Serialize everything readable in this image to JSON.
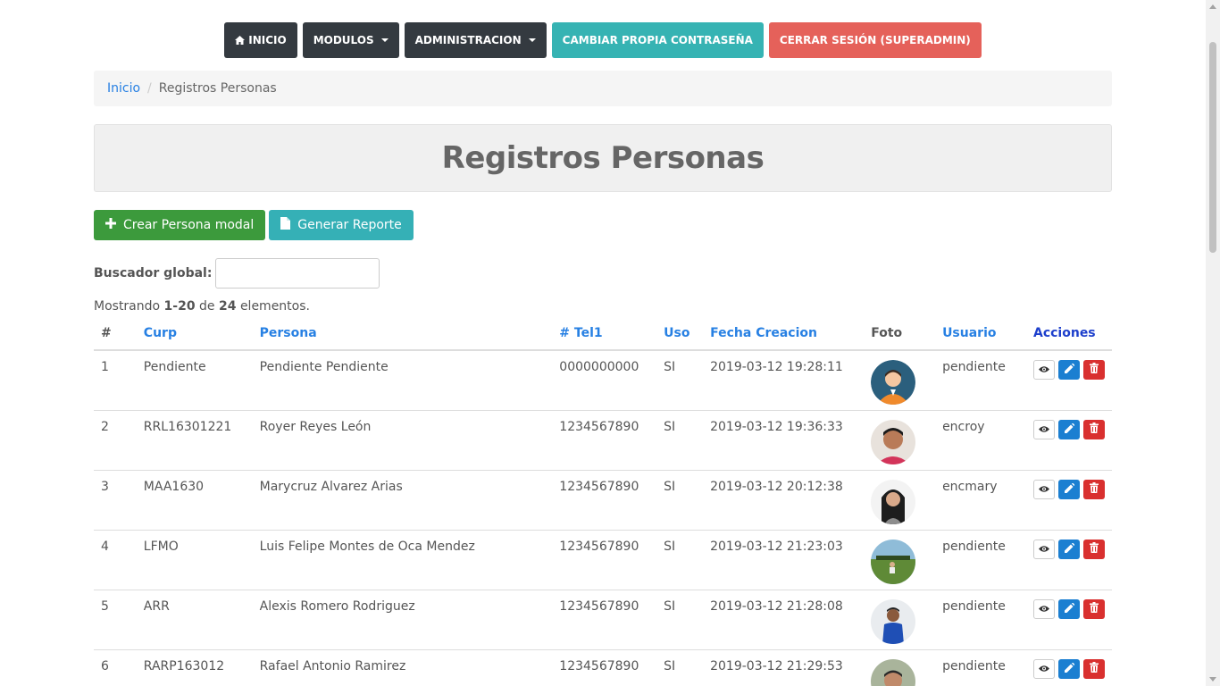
{
  "nav": {
    "home_label": "INICIO",
    "modulos_label": "MODULOS",
    "admin_label": "ADMINISTRACION",
    "change_password_label": "CAMBIAR PROPIA CONTRASEÑA",
    "logout_label": "CERRAR SESIÓN (SUPERADMIN)"
  },
  "breadcrumb": {
    "home": "Inicio",
    "separator": "/",
    "current": "Registros Personas"
  },
  "page_title": "Registros Personas",
  "toolbar": {
    "create_label": "Crear Persona modal",
    "report_label": "Generar Reporte"
  },
  "search": {
    "label": "Buscador global:",
    "value": ""
  },
  "summary": {
    "prefix": "Mostrando",
    "range": "1-20",
    "of": "de",
    "total": "24",
    "suffix": "elementos."
  },
  "table": {
    "headers": [
      "#",
      "Curp",
      "Persona",
      "# Tel1",
      "Uso",
      "Fecha Creacion",
      "Foto",
      "Usuario",
      "Acciones"
    ],
    "rows": [
      {
        "num": "1",
        "curp": "Pendiente",
        "persona": "Pendiente Pendiente",
        "tel": "0000000000",
        "uso": "SI",
        "fecha": "2019-03-12 19:28:11",
        "usuario": "pendiente"
      },
      {
        "num": "2",
        "curp": "RRL16301221",
        "persona": "Royer Reyes León",
        "tel": "1234567890",
        "uso": "SI",
        "fecha": "2019-03-12 19:36:33",
        "usuario": "encroy"
      },
      {
        "num": "3",
        "curp": "MAA1630",
        "persona": "Marycruz Alvarez Arias",
        "tel": "1234567890",
        "uso": "SI",
        "fecha": "2019-03-12 20:12:38",
        "usuario": "encmary"
      },
      {
        "num": "4",
        "curp": "LFMO",
        "persona": "Luis Felipe Montes de Oca Mendez",
        "tel": "1234567890",
        "uso": "SI",
        "fecha": "2019-03-12 21:23:03",
        "usuario": "pendiente"
      },
      {
        "num": "5",
        "curp": "ARR",
        "persona": "Alexis Romero Rodriguez",
        "tel": "1234567890",
        "uso": "SI",
        "fecha": "2019-03-12 21:28:08",
        "usuario": "pendiente"
      },
      {
        "num": "6",
        "curp": "RARP163012",
        "persona": "Rafael Antonio Ramirez",
        "tel": "1234567890",
        "uso": "SI",
        "fecha": "2019-03-12 21:29:53",
        "usuario": "pendiente"
      }
    ]
  },
  "colors": {
    "dark_nav": "#343a40",
    "teal": "#36b3b3",
    "red": "#e5615a",
    "green": "#3c9a3c",
    "link": "#2780e3",
    "edit": "#1b7fd1",
    "delete": "#d9302f"
  },
  "icons": [
    "home-icon",
    "plus-icon",
    "file-icon",
    "eye-icon",
    "pencil-icon",
    "trash-icon"
  ]
}
